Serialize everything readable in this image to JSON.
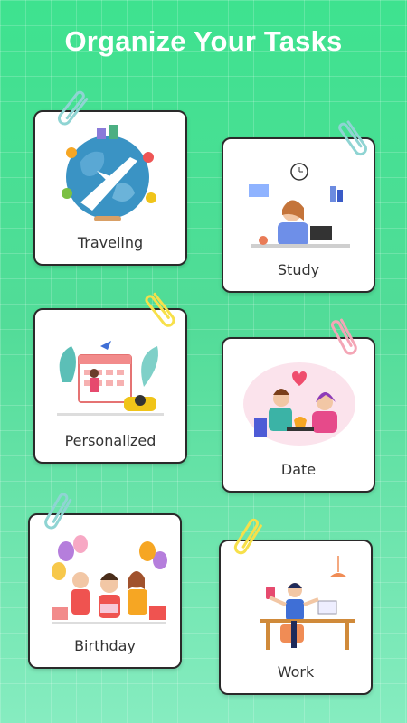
{
  "title": "Organize Your Tasks",
  "cards": [
    {
      "label": "Traveling",
      "icon": "traveling-globe-illustration",
      "clip_color": "#8fd4d3"
    },
    {
      "label": "Study",
      "icon": "study-desk-illustration",
      "clip_color": "#8fd4d3"
    },
    {
      "label": "Personalized",
      "icon": "calendar-illustration",
      "clip_color": "#f7e04a"
    },
    {
      "label": "Date",
      "icon": "date-couple-illustration",
      "clip_color": "#f4a6b6"
    },
    {
      "label": "Birthday",
      "icon": "birthday-party-illustration",
      "clip_color": "#8fd4d3"
    },
    {
      "label": "Work",
      "icon": "work-desk-illustration",
      "clip_color": "#f7e04a"
    }
  ],
  "colors": {
    "background_top": "#3ee28f",
    "background_bottom": "#86ecc0",
    "card": "#ffffff",
    "card_border": "#2a2a2a"
  }
}
